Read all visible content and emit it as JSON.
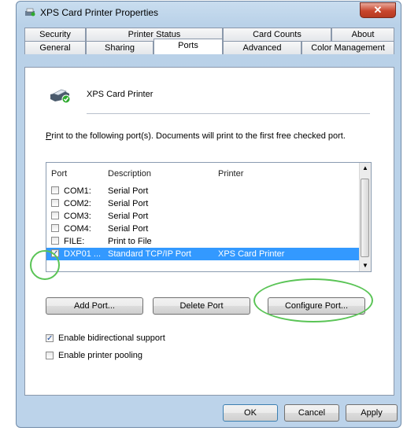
{
  "window": {
    "title": "XPS Card Printer Properties",
    "close_label": "✕"
  },
  "tabs_row1": [
    "Security",
    "Printer Status",
    "Card Counts",
    "About"
  ],
  "tabs_row2": [
    "General",
    "Sharing",
    "Ports",
    "Advanced",
    "Color Management"
  ],
  "active_tab": "Ports",
  "printer": {
    "name": "XPS Card Printer"
  },
  "description": {
    "first_letter": "P",
    "rest": "rint to the following port(s). Documents will print to the first free checked port."
  },
  "port_list": {
    "headers": {
      "port": "Port",
      "description": "Description",
      "printer": "Printer"
    },
    "rows": [
      {
        "port": "COM1:",
        "description": "Serial Port",
        "printer": "",
        "checked": false,
        "selected": false
      },
      {
        "port": "COM2:",
        "description": "Serial Port",
        "printer": "",
        "checked": false,
        "selected": false
      },
      {
        "port": "COM3:",
        "description": "Serial Port",
        "printer": "",
        "checked": false,
        "selected": false
      },
      {
        "port": "COM4:",
        "description": "Serial Port",
        "printer": "",
        "checked": false,
        "selected": false
      },
      {
        "port": "FILE:",
        "description": "Print to File",
        "printer": "",
        "checked": false,
        "selected": false
      },
      {
        "port": "DXP01 ...",
        "description": "Standard TCP/IP Port",
        "printer": "XPS Card Printer",
        "checked": true,
        "selected": true
      }
    ]
  },
  "buttons": {
    "add_port": "Add Port...",
    "delete_port": "Delete Port",
    "configure_port": "Configure Port..."
  },
  "options": {
    "bidirectional": {
      "label": "Enable bidirectional support",
      "checked": true
    },
    "pooling": {
      "label": "Enable printer pooling",
      "checked": false
    }
  },
  "footer": {
    "ok": "OK",
    "cancel": "Cancel",
    "apply": "Apply"
  },
  "colors": {
    "selection": "#3399ff",
    "highlight_ring": "#5ac456",
    "close_button": "#c8462d"
  }
}
